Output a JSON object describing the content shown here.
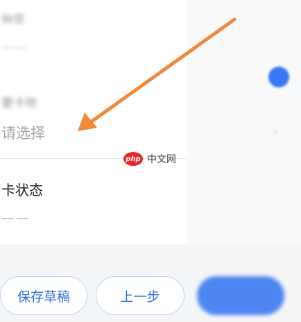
{
  "form": {
    "field_top": {
      "label": "种草",
      "value": "——"
    },
    "field_place": {
      "label": "要卡地",
      "placeholder": "请选择"
    },
    "field_status": {
      "label": "卡状态",
      "value": "——"
    }
  },
  "footer": {
    "save_draft_label": "保存草稿",
    "previous_label": "上一步"
  },
  "watermark": {
    "logo_text": "php",
    "site_text": "中文网"
  },
  "colors": {
    "accent_blue": "#3a78f2",
    "arrow_orange": "#f0893a",
    "button_text": "#2f6fe4"
  },
  "icons": {
    "chevron": "chevron-right-icon",
    "toggle": "blue-dot-icon",
    "annotation": "orange-arrow-icon"
  }
}
